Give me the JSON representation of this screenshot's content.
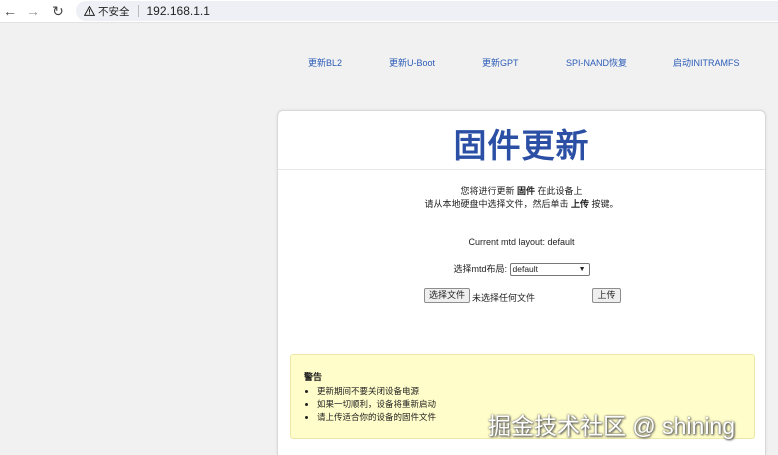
{
  "browser": {
    "security_label": "不安全",
    "url": "192.168.1.1"
  },
  "top_links": [
    "更新BL2",
    "更新U-Boot",
    "更新GPT",
    "SPI-NAND恢复",
    "启动INITRAMFS"
  ],
  "card": {
    "title": "固件更新",
    "line1_prefix": "您将进行更新",
    "line1_bold": "固件",
    "line1_suffix": "在此设备上",
    "line2_prefix": "请从本地硬盘中选择文件，然后单击",
    "line2_bold": "上传",
    "line2_suffix": "按键。",
    "mtd_layout": "Current mtd layout: default",
    "select_label": "选择mtd布局:",
    "select_value": "default",
    "choose_file_button": "选择文件",
    "no_file_text": "未选择任何文件",
    "upload_button": "上传"
  },
  "warning": {
    "title": "警告",
    "items": [
      "更新期间不要关闭设备电源",
      "如果一切顺利，设备将重新启动",
      "请上传适合你的设备的固件文件"
    ]
  },
  "watermark": "掘金技术社区 @ shining"
}
